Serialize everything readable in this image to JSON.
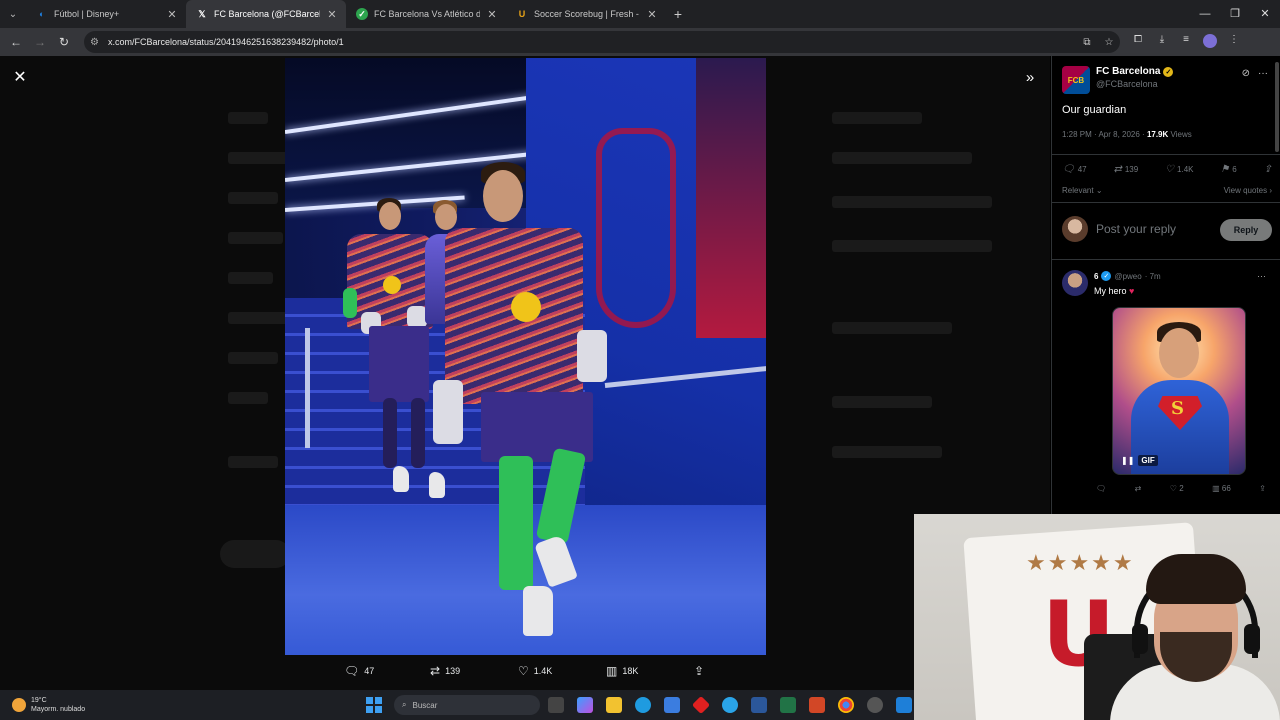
{
  "browser": {
    "tabs": [
      {
        "title": "Fútbol | Disney+",
        "favicon_color": "#1f80e0",
        "active": false
      },
      {
        "title": "FC Barcelona (@FCBarcelona) /",
        "favicon_color": "#000000",
        "active": true
      },
      {
        "title": "FC Barcelona Vs Atlético de Ma",
        "favicon_color": "#2da44e",
        "active": false
      },
      {
        "title": "Soccer Scorebug | Fresh - overli",
        "favicon_color": "#e8a317",
        "active": false
      }
    ],
    "url": "x.com/FCBarcelona/status/2041946251638239482/photo/1"
  },
  "photo_actions": {
    "replies": "47",
    "reposts": "139",
    "likes": "1.4K",
    "views": "18K"
  },
  "tweet": {
    "account_name": "FC Barcelona",
    "handle": "@FCBarcelona",
    "text": "Our guardian",
    "time": "1:28 PM · Apr 8, 2026 · ",
    "views_count": "17.9K",
    "views_label": " Views",
    "stats": {
      "replies": "47",
      "reposts": "139",
      "likes": "1.4K",
      "bookmarks": "6"
    },
    "sort_label": "Relevant",
    "view_quotes": "View quotes",
    "reply_placeholder": "Post your reply",
    "reply_button": "Reply"
  },
  "reply": {
    "name": "6",
    "handle": "@pweo",
    "time": "· 7m",
    "text": "My hero",
    "gif_badge": "GIF",
    "stats": {
      "replies": "",
      "reposts": "",
      "likes": "2",
      "views": "66"
    }
  },
  "webcam": {
    "shirt_stars": "★★★★★"
  },
  "taskbar": {
    "temperature": "19°C",
    "weather_desc": "Mayorm. nublado",
    "search_placeholder": "Buscar"
  },
  "colors": {
    "accent_blue": "#1d9bf0",
    "like_red": "#f91880",
    "gold_verified": "#e2b719"
  }
}
